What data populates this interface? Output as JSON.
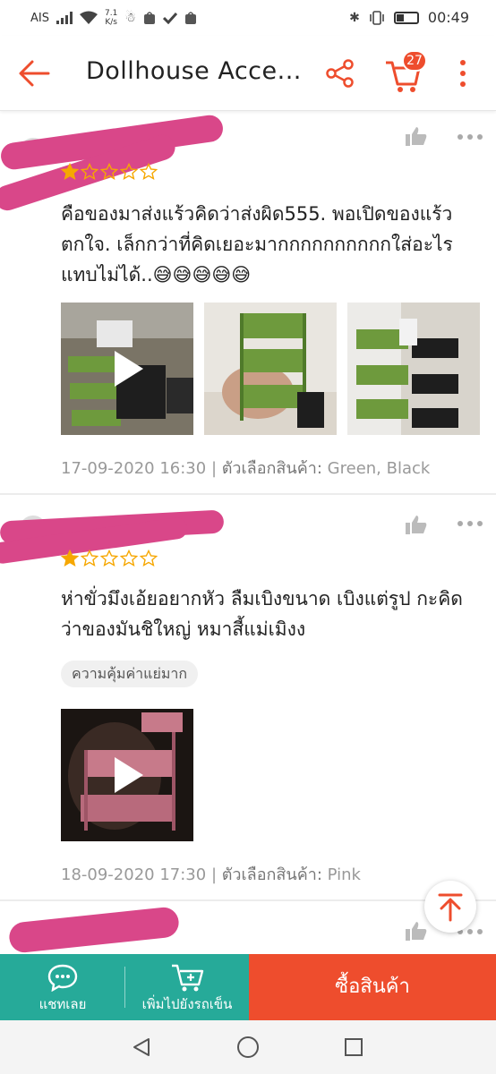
{
  "status_bar": {
    "carrier": "AIS",
    "net_speed_value": "7.1",
    "net_speed_unit": "K/s",
    "battery_level": 0.35,
    "time": "00:49",
    "icons": [
      "signal-icon",
      "wifi-icon",
      "notification-icon",
      "shopee-icon",
      "check-icon",
      "shopee-icon",
      "bluetooth-icon",
      "vibrate-icon",
      "battery-icon"
    ]
  },
  "app_bar": {
    "title": "Dollhouse Acce...",
    "cart_count": "27"
  },
  "reviews": [
    {
      "rating": 1,
      "max_rating": 5,
      "text": "คือของมาส่งแร้วคิดว่าส่งผิด555.  พอเปิดของแร้วตกใจ.  เล็กกว่าที่คิดเยอะมากกกกกกกกกกใส่อะไรแทบไม่ได้..😅😅😅😅😅",
      "media": [
        {
          "type": "video",
          "name": "green-black-cart-video"
        },
        {
          "type": "image",
          "name": "green-cart-in-hand-photo"
        },
        {
          "type": "image",
          "name": "green-and-black-carts-photo"
        }
      ],
      "date": "17-09-2020 16:30",
      "variant_label": "ตัวเลือกสินค้า:",
      "variant_value": "Green, Black"
    },
    {
      "rating": 1,
      "max_rating": 5,
      "text": "ห่าขั่วมึงเอ้ยอยากหัว  ลืมเบิงขนาด เบิงแต่รูป กะคิดว่าของมันชิใหญ่  หมาสี้แม่เมิงง",
      "tag": "ความคุ้มค่าแย่มาก",
      "media": [
        {
          "type": "video",
          "name": "pink-cart-video"
        }
      ],
      "date": "18-09-2020 17:30",
      "variant_label": "ตัวเลือกสินค้า:",
      "variant_value": "Pink"
    }
  ],
  "colors": {
    "brand": "#ee4d2d",
    "teal": "#26aa99",
    "star": "#f6a700",
    "redaction": "#d94789"
  },
  "actions": {
    "chat_label": "แชทเลย",
    "add_to_cart_label": "เพิ่มไปยังรถเข็น",
    "buy_label": "ซื้อสินค้า"
  }
}
